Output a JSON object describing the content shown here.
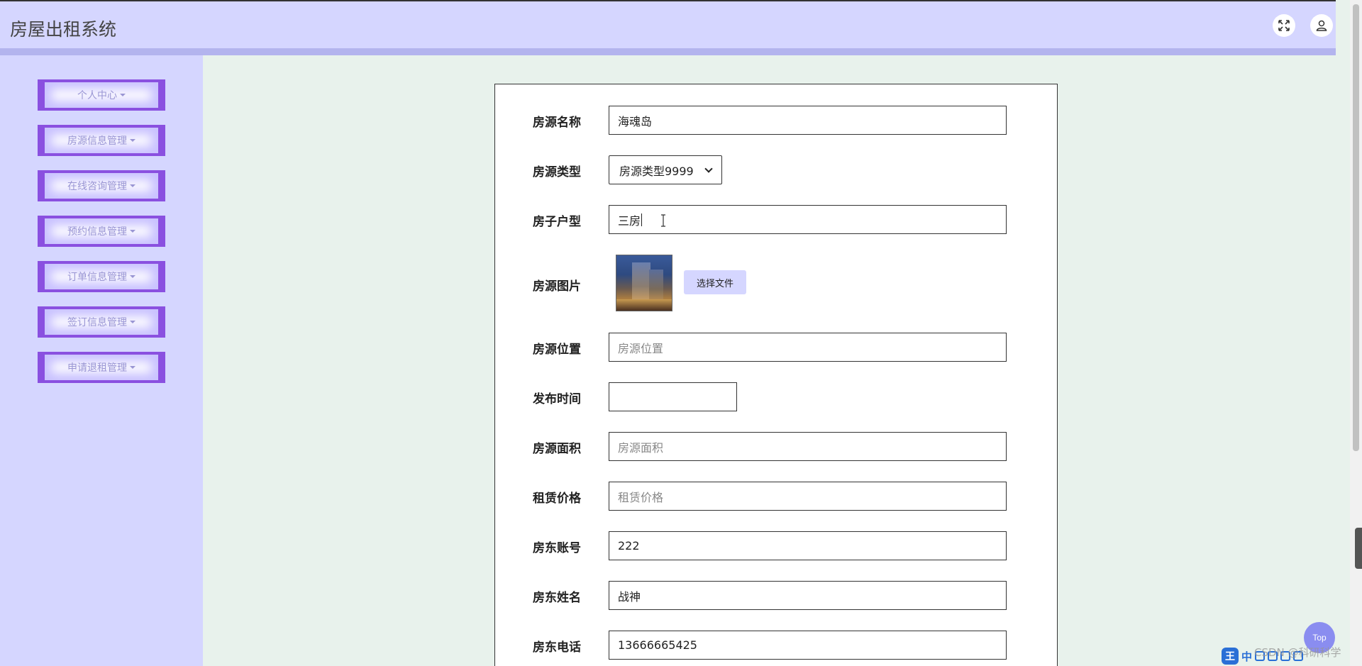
{
  "header": {
    "title": "房屋出租系统",
    "fullscreen_icon": "expand-icon",
    "user_icon": "user-icon"
  },
  "sidebar": {
    "items": [
      {
        "label": "个人中心"
      },
      {
        "label": "房源信息管理"
      },
      {
        "label": "在线咨询管理"
      },
      {
        "label": "预约信息管理"
      },
      {
        "label": "订单信息管理"
      },
      {
        "label": "签订信息管理"
      },
      {
        "label": "申请退租管理"
      }
    ]
  },
  "form": {
    "name": {
      "label": "房源名称",
      "value": "海魂岛"
    },
    "type": {
      "label": "房源类型",
      "value": "房源类型9999"
    },
    "layout": {
      "label": "房子户型",
      "value": "三房"
    },
    "image": {
      "label": "房源图片",
      "button": "选择文件"
    },
    "location": {
      "label": "房源位置",
      "placeholder": "房源位置"
    },
    "publish_time": {
      "label": "发布时间",
      "value": ""
    },
    "area": {
      "label": "房源面积",
      "placeholder": "房源面积"
    },
    "price": {
      "label": "租赁价格",
      "placeholder": "租赁价格"
    },
    "landlord_account": {
      "label": "房东账号",
      "value": "222"
    },
    "landlord_name": {
      "label": "房东姓名",
      "value": "战神"
    },
    "landlord_phone": {
      "label": "房东电话",
      "value": "13666665425"
    }
  },
  "top_button": "Top",
  "watermark": "CSDN @科研科学",
  "ime": {
    "logo": "王",
    "mode": "中"
  },
  "colors": {
    "header_bg": "#d5d6ff",
    "accent": "#8a50e0",
    "content_bg": "#e8f2ec",
    "file_button_bg": "#d5d6ff"
  }
}
